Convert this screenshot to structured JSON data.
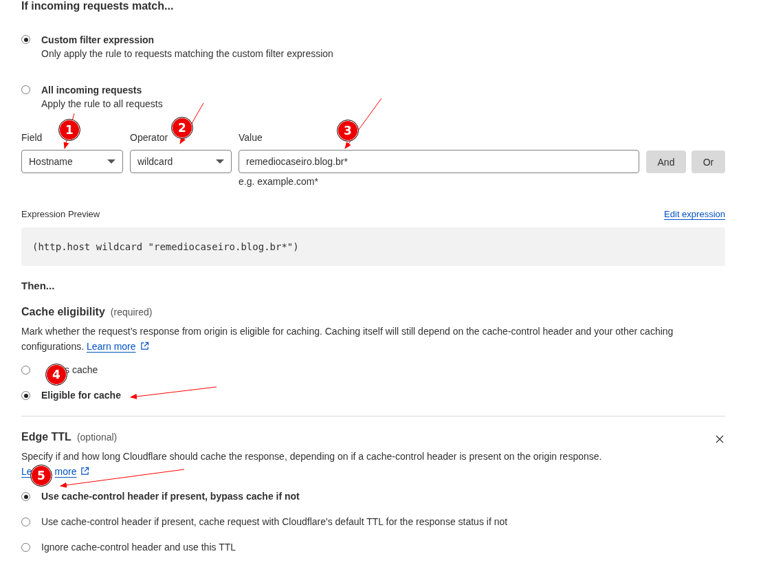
{
  "match": {
    "heading": "If incoming requests match...",
    "options": [
      {
        "label": "Custom filter expression",
        "description": "Only apply the rule to requests matching the custom filter expression",
        "selected": true
      },
      {
        "label": "All incoming requests",
        "description": "Apply the rule to all requests",
        "selected": false
      }
    ]
  },
  "filter": {
    "field": {
      "label": "Field",
      "value": "Hostname"
    },
    "operator": {
      "label": "Operator",
      "value": "wildcard"
    },
    "value": {
      "label": "Value",
      "value": "remediocaseiro.blog.br*",
      "hint": "e.g. example.com*"
    },
    "buttons": [
      "And",
      "Or"
    ]
  },
  "preview": {
    "label": "Expression Preview",
    "link": "Edit expression",
    "code": "(http.host wildcard \"remediocaseiro.blog.br*\")"
  },
  "then": {
    "heading": "Then..."
  },
  "sections": [
    {
      "title": "Cache eligibility",
      "note": "(required)",
      "description": "Mark whether the request’s response from origin is eligible for caching. Caching itself will still depend on the cache-control header and your other caching configurations.",
      "link_parts": [
        "Learn more"
      ],
      "closable": false,
      "options": [
        {
          "label": "s cache",
          "selected": false
        },
        {
          "label": "Eligible for cache",
          "selected": true
        }
      ]
    },
    {
      "title": "Edge TTL",
      "note": "(optional)",
      "description": "Specify if and how long Cloudflare should cache the response, depending on if a cache-control header is present on the origin response.",
      "link_parts": [
        "Le",
        "more"
      ],
      "closable": true,
      "options": [
        {
          "label": "Use cache-control header if present, bypass cache if not",
          "selected": true
        },
        {
          "label": "Use cache-control header if present, cache request with Cloudflare's default TTL for the response status if not",
          "selected": false
        },
        {
          "label": "Ignore cache-control header and use this TTL",
          "selected": false
        }
      ]
    }
  ],
  "annotations": [
    {
      "number": "1"
    },
    {
      "number": "2"
    },
    {
      "number": "3"
    },
    {
      "number": "4"
    },
    {
      "number": "5"
    }
  ]
}
